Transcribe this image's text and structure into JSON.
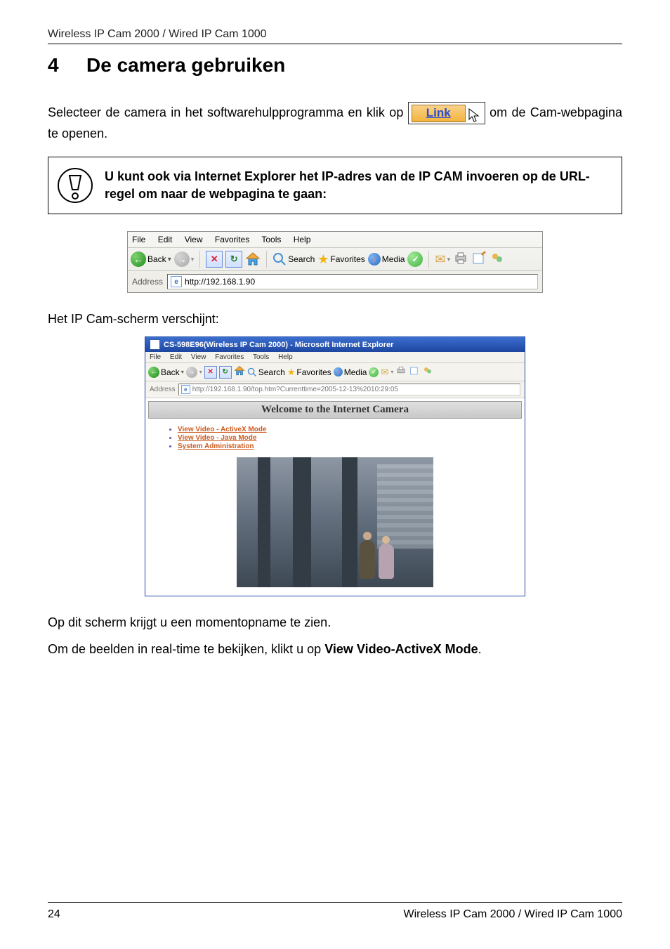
{
  "doc": {
    "product_header": "Wireless IP Cam 2000 / Wired IP Cam 1000",
    "section_number": "4",
    "section_title": "De camera gebruiken",
    "paragraphs": {
      "intro_prefix": "Selecteer de camera in het softwarehulpprogramma en klik op ",
      "intro_suffix": " om de Cam-webpagina te openen.",
      "callout": "U kunt ook via Internet Explorer het IP-adres van de IP CAM invoeren op de URL-regel om naar de webpagina te gaan:",
      "after_toolbar": "Het IP Cam-scherm verschijnt:",
      "after_window": "Op dit scherm krijgt u een momentopname te zien.",
      "last_prefix": "Om de beelden in real-time te bekijken, klikt u op ",
      "last_bold": "View Video-ActiveX Mode",
      "last_suffix": "."
    },
    "link_button_label": "Link"
  },
  "ie_bar": {
    "menus": [
      "File",
      "Edit",
      "View",
      "Favorites",
      "Tools",
      "Help"
    ],
    "back_label": "Back",
    "search_label": "Search",
    "favorites_label": "Favorites",
    "media_label": "Media",
    "address_label": "Address",
    "address_value": "http://192.168.1.90"
  },
  "ipcam_window": {
    "title": "CS-598E96(Wireless IP Cam 2000) - Microsoft Internet Explorer",
    "menus": [
      "File",
      "Edit",
      "View",
      "Favorites",
      "Tools",
      "Help"
    ],
    "back_label": "Back",
    "search_label": "Search",
    "favorites_label": "Favorites",
    "media_label": "Media",
    "address_label": "Address",
    "address_value": "http://192.168.1.90/top.htm?Currenttime=2005-12-13%2010:29:05",
    "welcome": "Welcome to the Internet Camera",
    "links": [
      "View Video - ActiveX Mode",
      "View Video - Java Mode",
      "System Administration"
    ]
  },
  "footer": {
    "page_number": "24",
    "product": "Wireless IP Cam 2000 / Wired IP Cam 1000"
  }
}
